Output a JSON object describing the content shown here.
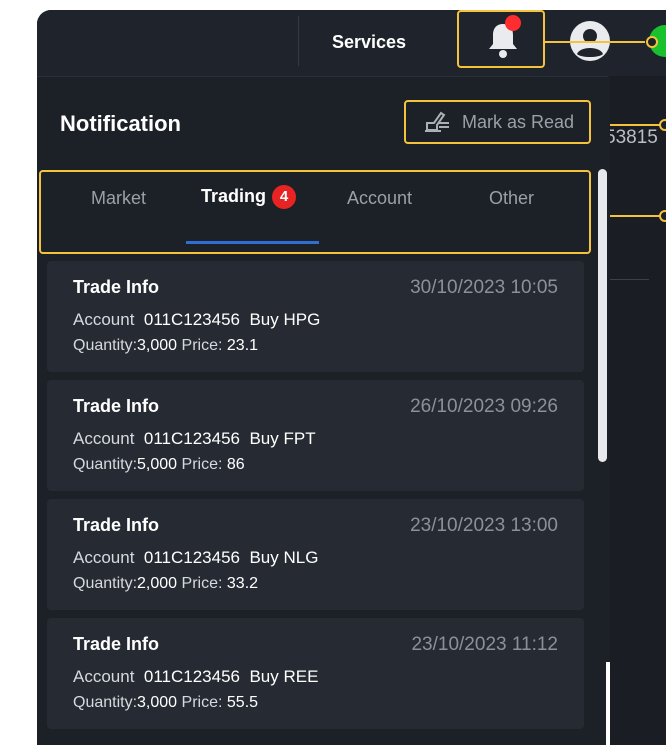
{
  "topbar": {
    "services_label": "Services"
  },
  "side": {
    "ticker_text": "53815"
  },
  "notification": {
    "title": "Notification",
    "mark_as_read_label": "Mark as Read",
    "tabs": [
      {
        "label": "Market"
      },
      {
        "label": "Trading",
        "badge": "4"
      },
      {
        "label": "Account"
      },
      {
        "label": "Other"
      }
    ],
    "items": [
      {
        "title": "Trade Info",
        "time": "30/10/2023 10:05",
        "account_label": "Account",
        "account": "011C123456",
        "action": "Buy HPG",
        "quantity_label": "Quantity:",
        "quantity": "3,000",
        "price_label": "Price:",
        "price": "23.1"
      },
      {
        "title": "Trade Info",
        "time": "26/10/2023 09:26",
        "account_label": "Account",
        "account": "011C123456",
        "action": "Buy FPT",
        "quantity_label": "Quantity:",
        "quantity": "5,000",
        "price_label": "Price:",
        "price": "86"
      },
      {
        "title": "Trade Info",
        "time": "23/10/2023 13:00",
        "account_label": "Account",
        "account": "011C123456",
        "action": "Buy NLG",
        "quantity_label": "Quantity:",
        "quantity": "2,000",
        "price_label": "Price:",
        "price": "33.2"
      },
      {
        "title": "Trade Info",
        "time": "23/10/2023 11:12",
        "account_label": "Account",
        "account": "011C123456",
        "action": "Buy REE",
        "quantity_label": "Quantity:",
        "quantity": "3,000",
        "price_label": "Price:",
        "price": "55.5"
      }
    ]
  },
  "colors": {
    "highlight": "#f5c33b",
    "badge": "#e82323",
    "tab_underline": "#2f6fd4",
    "notification_dot": "#ff2d2d"
  },
  "icons": {
    "bell": "bell-icon",
    "user": "user-icon",
    "mark_read": "mark-read-icon"
  }
}
